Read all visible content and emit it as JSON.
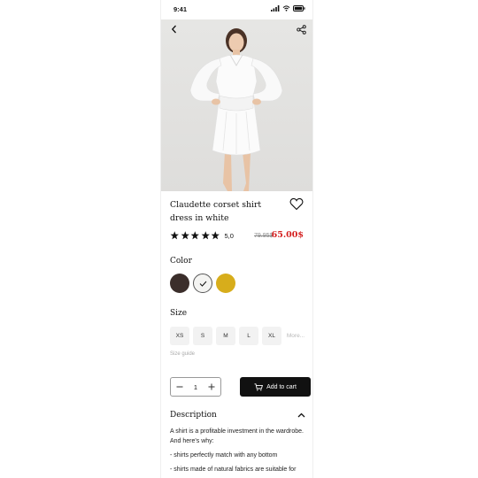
{
  "status_bar": {
    "time": "9:41"
  },
  "product": {
    "title": "Claudette corset shirt dress in white",
    "rating": "5,0",
    "old_price": "79.95$",
    "price": "65.00$"
  },
  "color_section": {
    "title": "Color",
    "swatches": [
      {
        "name": "dark-brown",
        "color": "#3b2e2b"
      },
      {
        "name": "white",
        "color": "#f4f4f2",
        "selected": true
      },
      {
        "name": "mustard",
        "color": "#d7ad1b"
      }
    ]
  },
  "size_section": {
    "title": "Size",
    "sizes": [
      "XS",
      "S",
      "M",
      "L",
      "XL"
    ],
    "more_label": "More...",
    "guide_label": "Size guide"
  },
  "quantity": "1",
  "cart": {
    "label": "Add to cart"
  },
  "description": {
    "title": "Description",
    "paragraphs": [
      "A shirt is a profitable investment in the wardrobe. And here's why:",
      "- shirts perfectly match with any bottom",
      "- shirts made of natural fabrics are suitable for"
    ]
  }
}
